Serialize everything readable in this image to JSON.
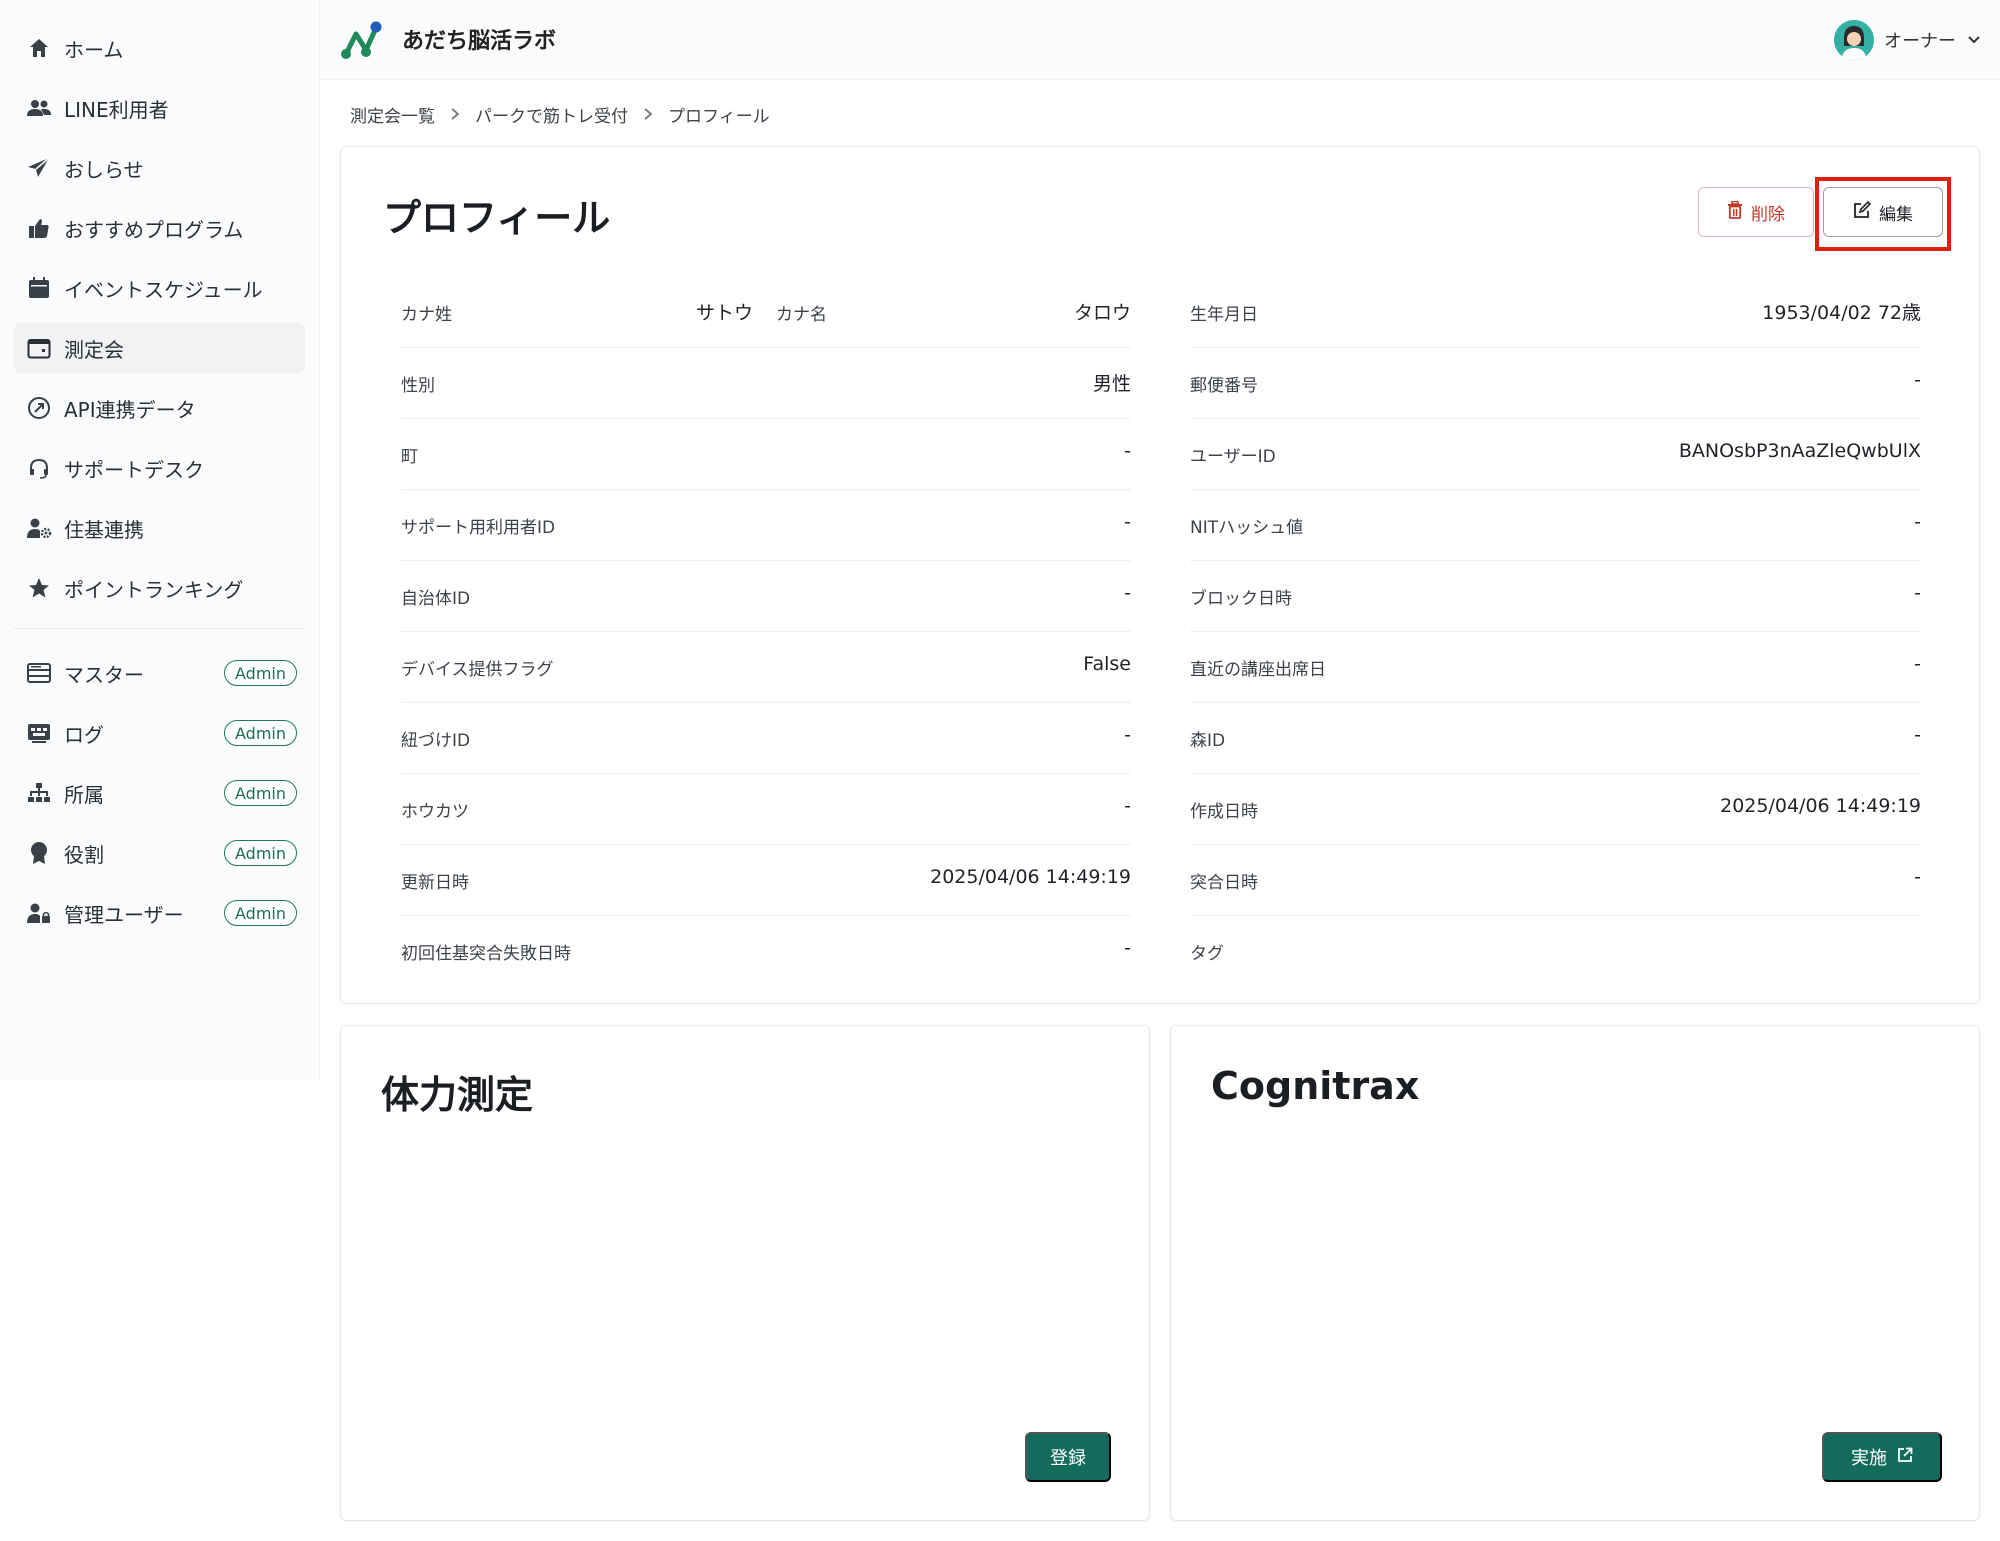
{
  "app": {
    "title": "あだち脳活ラボ"
  },
  "user": {
    "name": "オーナー"
  },
  "sidebar": {
    "items": [
      {
        "label": "ホーム",
        "icon": "home-icon"
      },
      {
        "label": "LINE利用者",
        "icon": "users-icon"
      },
      {
        "label": "おしらせ",
        "icon": "paper-plane-icon"
      },
      {
        "label": "おすすめプログラム",
        "icon": "thumbs-up-icon"
      },
      {
        "label": "イベントスケジュール",
        "icon": "calendar-icon"
      },
      {
        "label": "測定会",
        "icon": "calendar-blank-icon",
        "active": true
      },
      {
        "label": "API連携データ",
        "icon": "api-icon"
      },
      {
        "label": "サポートデスク",
        "icon": "headset-icon"
      },
      {
        "label": "住基連携",
        "icon": "user-gear-icon"
      },
      {
        "label": "ポイントランキング",
        "icon": "star-icon"
      }
    ],
    "admin_items": [
      {
        "label": "マスター",
        "badge": "Admin",
        "icon": "database-icon"
      },
      {
        "label": "ログ",
        "badge": "Admin",
        "icon": "log-icon"
      },
      {
        "label": "所属",
        "badge": "Admin",
        "icon": "org-chart-icon"
      },
      {
        "label": "役割",
        "badge": "Admin",
        "icon": "award-icon"
      },
      {
        "label": "管理ユーザー",
        "badge": "Admin",
        "icon": "user-lock-icon"
      }
    ]
  },
  "breadcrumb": [
    "測定会一覧",
    "パークで筋トレ受付",
    "プロフィール"
  ],
  "profile": {
    "title": "プロフィール",
    "delete_label": "削除",
    "edit_label": "編集",
    "kana": {
      "sei_label": "カナ姓",
      "sei_value": "サトウ",
      "mei_label": "カナ名",
      "mei_value": "タロウ"
    },
    "left": [
      {
        "label": "性別",
        "value": "男性"
      },
      {
        "label": "町",
        "value": "-"
      },
      {
        "label": "サポート用利用者ID",
        "value": "-"
      },
      {
        "label": "自治体ID",
        "value": "-"
      },
      {
        "label": "デバイス提供フラグ",
        "value": "False"
      },
      {
        "label": "紐づけID",
        "value": "-"
      },
      {
        "label": "ホウカツ",
        "value": "-"
      },
      {
        "label": "更新日時",
        "value": "2025/04/06 14:49:19"
      },
      {
        "label": "初回住基突合失敗日時",
        "value": "-"
      }
    ],
    "right": [
      {
        "label": "生年月日",
        "value": "1953/04/02 72歳"
      },
      {
        "label": "郵便番号",
        "value": "-"
      },
      {
        "label": "ユーザーID",
        "value": "BANOsbP3nAaZleQwbUlX"
      },
      {
        "label": "NITハッシュ値",
        "value": "-"
      },
      {
        "label": "ブロック日時",
        "value": "-"
      },
      {
        "label": "直近の講座出席日",
        "value": "-"
      },
      {
        "label": "森ID",
        "value": "-"
      },
      {
        "label": "作成日時",
        "value": "2025/04/06 14:49:19"
      },
      {
        "label": "突合日時",
        "value": "-"
      },
      {
        "label": "タグ",
        "value": ""
      }
    ]
  },
  "fitness": {
    "title": "体力測定",
    "button_label": "登録"
  },
  "cognitrax": {
    "title": "Cognitrax",
    "button_label": "実施"
  },
  "colors": {
    "primary": "#136b5c",
    "danger": "#c0392b",
    "highlight": "#e21e10"
  }
}
